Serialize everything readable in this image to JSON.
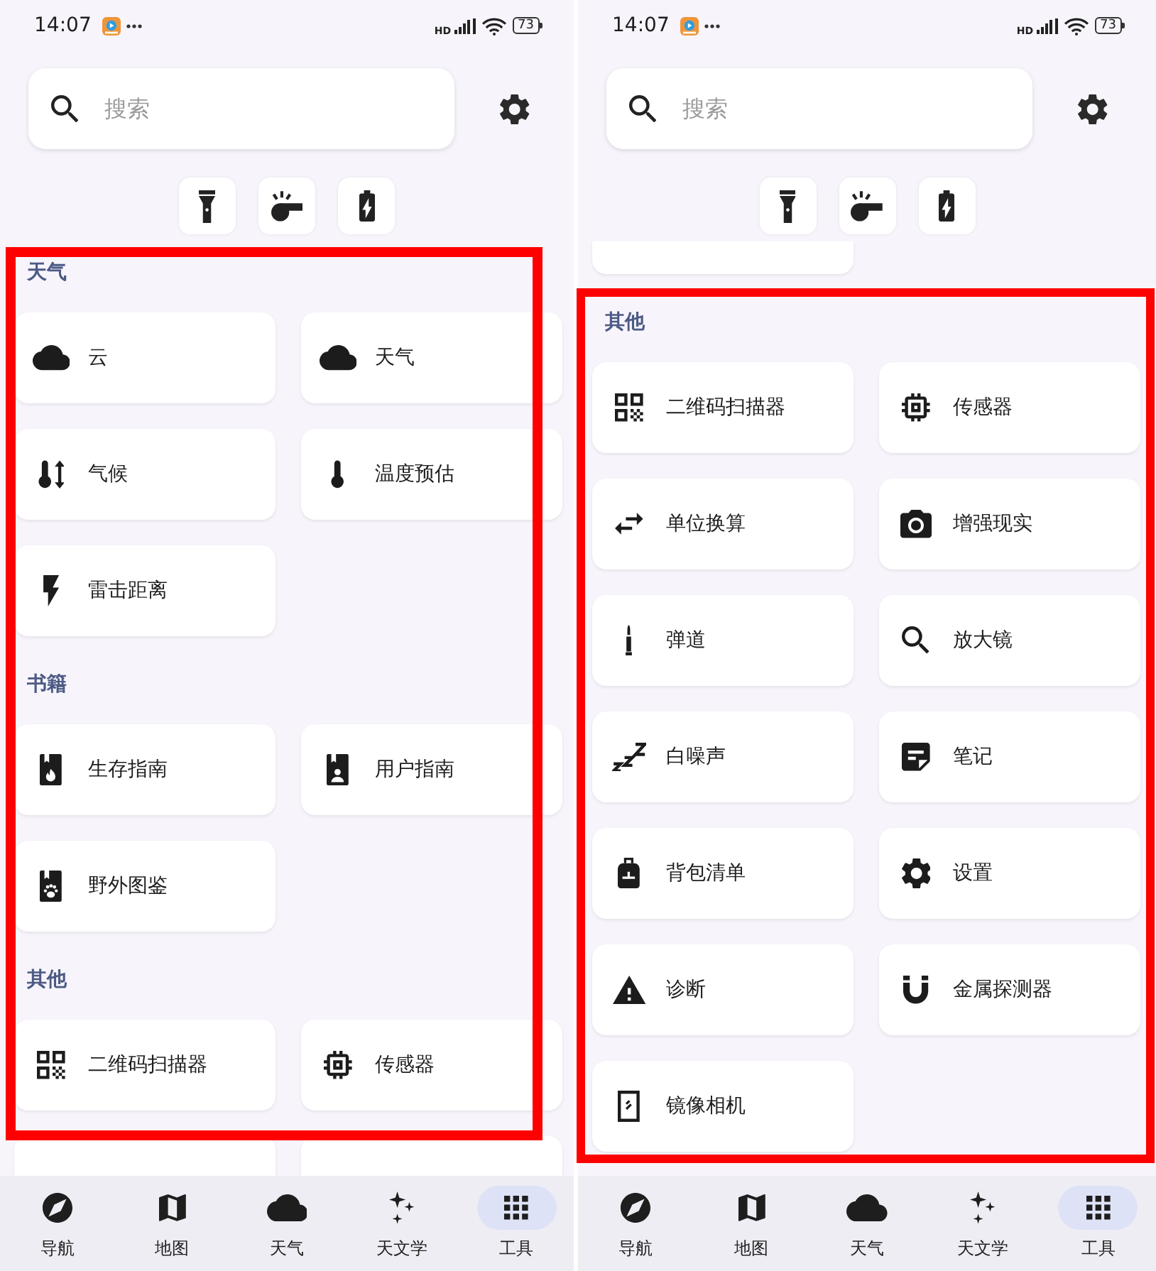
{
  "screens": [
    {
      "status_bar": {
        "time": "14:07",
        "network": "HD",
        "battery": "73"
      },
      "search": {
        "placeholder": "搜索"
      },
      "sections": [
        {
          "title": "天气",
          "items": [
            {
              "kind": "tool",
              "label": "云"
            },
            {
              "kind": "tool",
              "label": "天气"
            },
            {
              "kind": "tool",
              "label": "气候"
            },
            {
              "kind": "tool",
              "label": "温度预估"
            },
            {
              "kind": "tool",
              "label": "雷击距离"
            }
          ]
        },
        {
          "title": "书籍",
          "items": [
            {
              "kind": "tool",
              "label": "生存指南"
            },
            {
              "kind": "tool",
              "label": "用户指南"
            },
            {
              "kind": "tool",
              "label": "野外图鉴"
            }
          ]
        },
        {
          "title": "其他",
          "items": [
            {
              "kind": "tool",
              "label": "二维码扫描器"
            },
            {
              "kind": "tool",
              "label": "传感器"
            },
            {
              "kind": "cut_off"
            },
            {
              "kind": "cut_off"
            }
          ]
        }
      ],
      "highlight_frame": true,
      "bottom_nav": [
        {
          "label": "导航",
          "selected": false
        },
        {
          "label": "地图",
          "selected": false
        },
        {
          "label": "天气",
          "selected": false
        },
        {
          "label": "天文学",
          "selected": false
        },
        {
          "label": "工具",
          "selected": true
        }
      ]
    },
    {
      "status_bar": {
        "time": "14:07",
        "network": "HD",
        "battery": "73"
      },
      "search": {
        "placeholder": "搜索"
      },
      "sections": [
        {
          "items": [
            {
              "kind": "cut_off"
            }
          ]
        },
        {
          "title": "其他",
          "items": [
            {
              "kind": "tool",
              "label": "二维码扫描器"
            },
            {
              "kind": "tool",
              "label": "传感器"
            },
            {
              "kind": "tool",
              "label": "单位换算"
            },
            {
              "kind": "tool",
              "label": "增强现实"
            },
            {
              "kind": "tool",
              "label": "弹道"
            },
            {
              "kind": "tool",
              "label": "放大镜"
            },
            {
              "kind": "tool",
              "label": "白噪声"
            },
            {
              "kind": "tool",
              "label": "笔记"
            },
            {
              "kind": "tool",
              "label": "背包清单"
            },
            {
              "kind": "tool",
              "label": "设置"
            },
            {
              "kind": "tool",
              "label": "诊断"
            },
            {
              "kind": "tool",
              "label": "金属探测器"
            },
            {
              "kind": "tool",
              "label": "镜像相机"
            }
          ]
        }
      ],
      "highlight_frame": true,
      "bottom_nav": [
        {
          "label": "导航",
          "selected": false
        },
        {
          "label": "地图",
          "selected": false
        },
        {
          "label": "天气",
          "selected": false
        },
        {
          "label": "天文学",
          "selected": false
        },
        {
          "label": "工具",
          "selected": true
        }
      ]
    }
  ]
}
